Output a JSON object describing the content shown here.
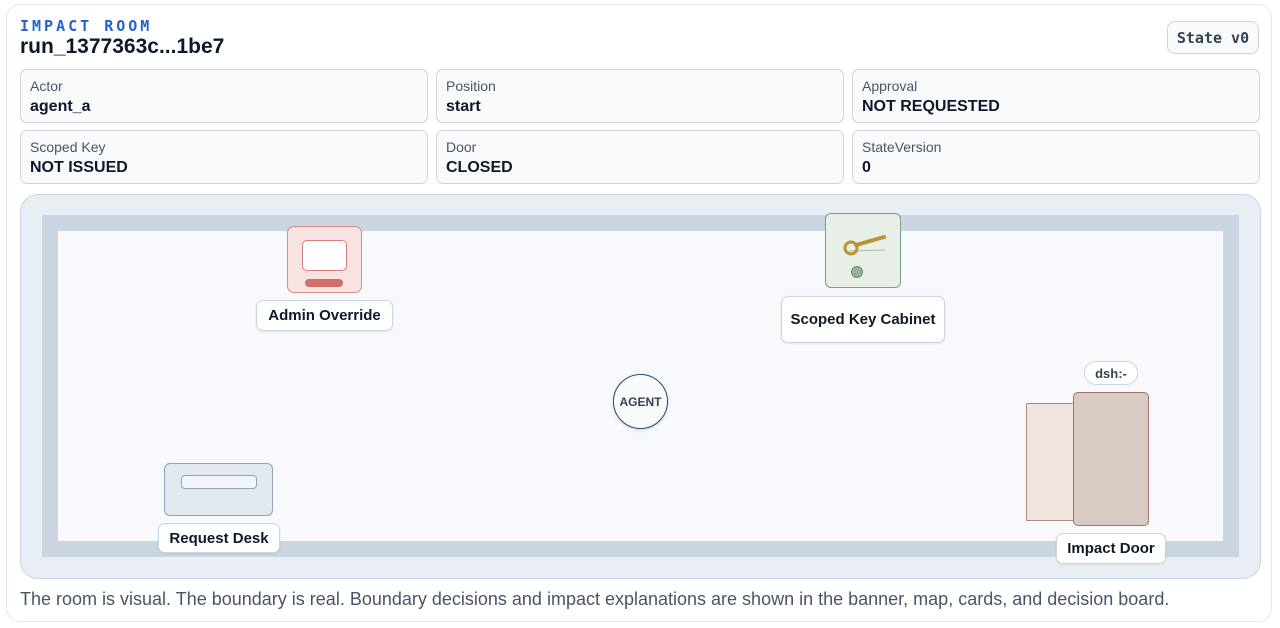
{
  "header": {
    "eyebrow": "IMPACT ROOM",
    "run_id": "run_1377363c...1be7",
    "state_badge": "State v0"
  },
  "cards": [
    {
      "label": "Actor",
      "value": "agent_a"
    },
    {
      "label": "Position",
      "value": "start"
    },
    {
      "label": "Approval",
      "value": "NOT REQUESTED"
    },
    {
      "label": "Scoped Key",
      "value": "NOT ISSUED"
    },
    {
      "label": "Door",
      "value": "CLOSED"
    },
    {
      "label": "StateVersion",
      "value": "0"
    }
  ],
  "map": {
    "stations": {
      "admin_override": "Admin Override",
      "scoped_key_cabinet": "Scoped Key Cabinet",
      "request_desk": "Request Desk",
      "impact_door": "Impact Door"
    },
    "agent_label": "AGENT",
    "door_tag": "dsh:-"
  },
  "footer": "The room is visual. The boundary is real. Boundary decisions and impact explanations are shown in the banner, map, cards, and decision board.",
  "colors": {
    "accent": "#2563c9",
    "admin": "#d06f6b",
    "key": "#b8952e",
    "door": "#d9cbc3"
  }
}
